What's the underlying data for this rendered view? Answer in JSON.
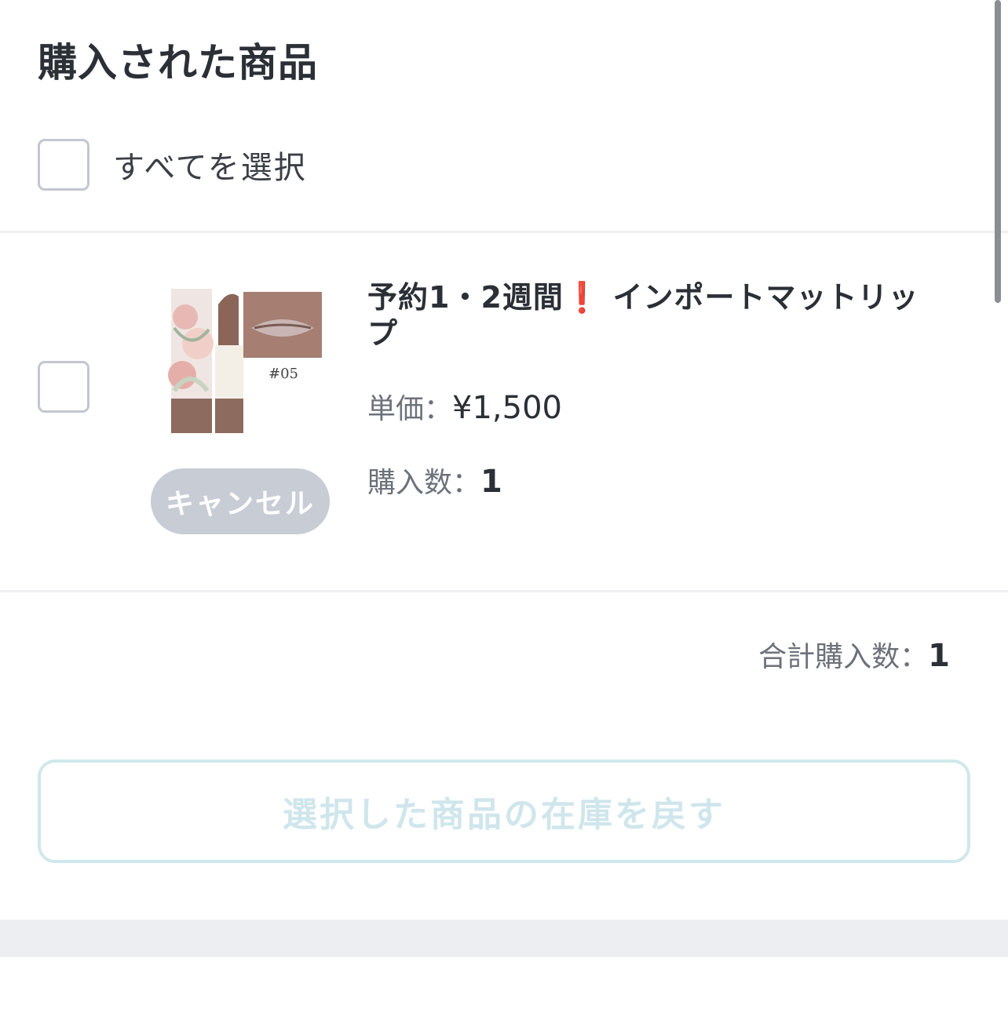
{
  "section_title": "購入された商品",
  "select_all_label": "すべてを選択",
  "item": {
    "name_before": "予約1・2週間",
    "name_warn": "❗",
    "name_after": "インポートマットリップ",
    "thumb_shade": "#05",
    "price_label": "単価：",
    "price_value": "¥1,500",
    "qty_label": "購入数：",
    "qty_value": "1",
    "cancel_label": "キャンセル"
  },
  "summary": {
    "total_label": "合計購入数：",
    "total_value": "1"
  },
  "restock_button_label": "選択した商品の在庫を戻す",
  "colors": {
    "text": "#2b2f36",
    "muted": "#6c717a",
    "checkbox_border": "#c3c7cf",
    "cancel_bg": "#c8ccd5",
    "restock_border": "#cfe8ec",
    "warn": "#d8242a"
  }
}
